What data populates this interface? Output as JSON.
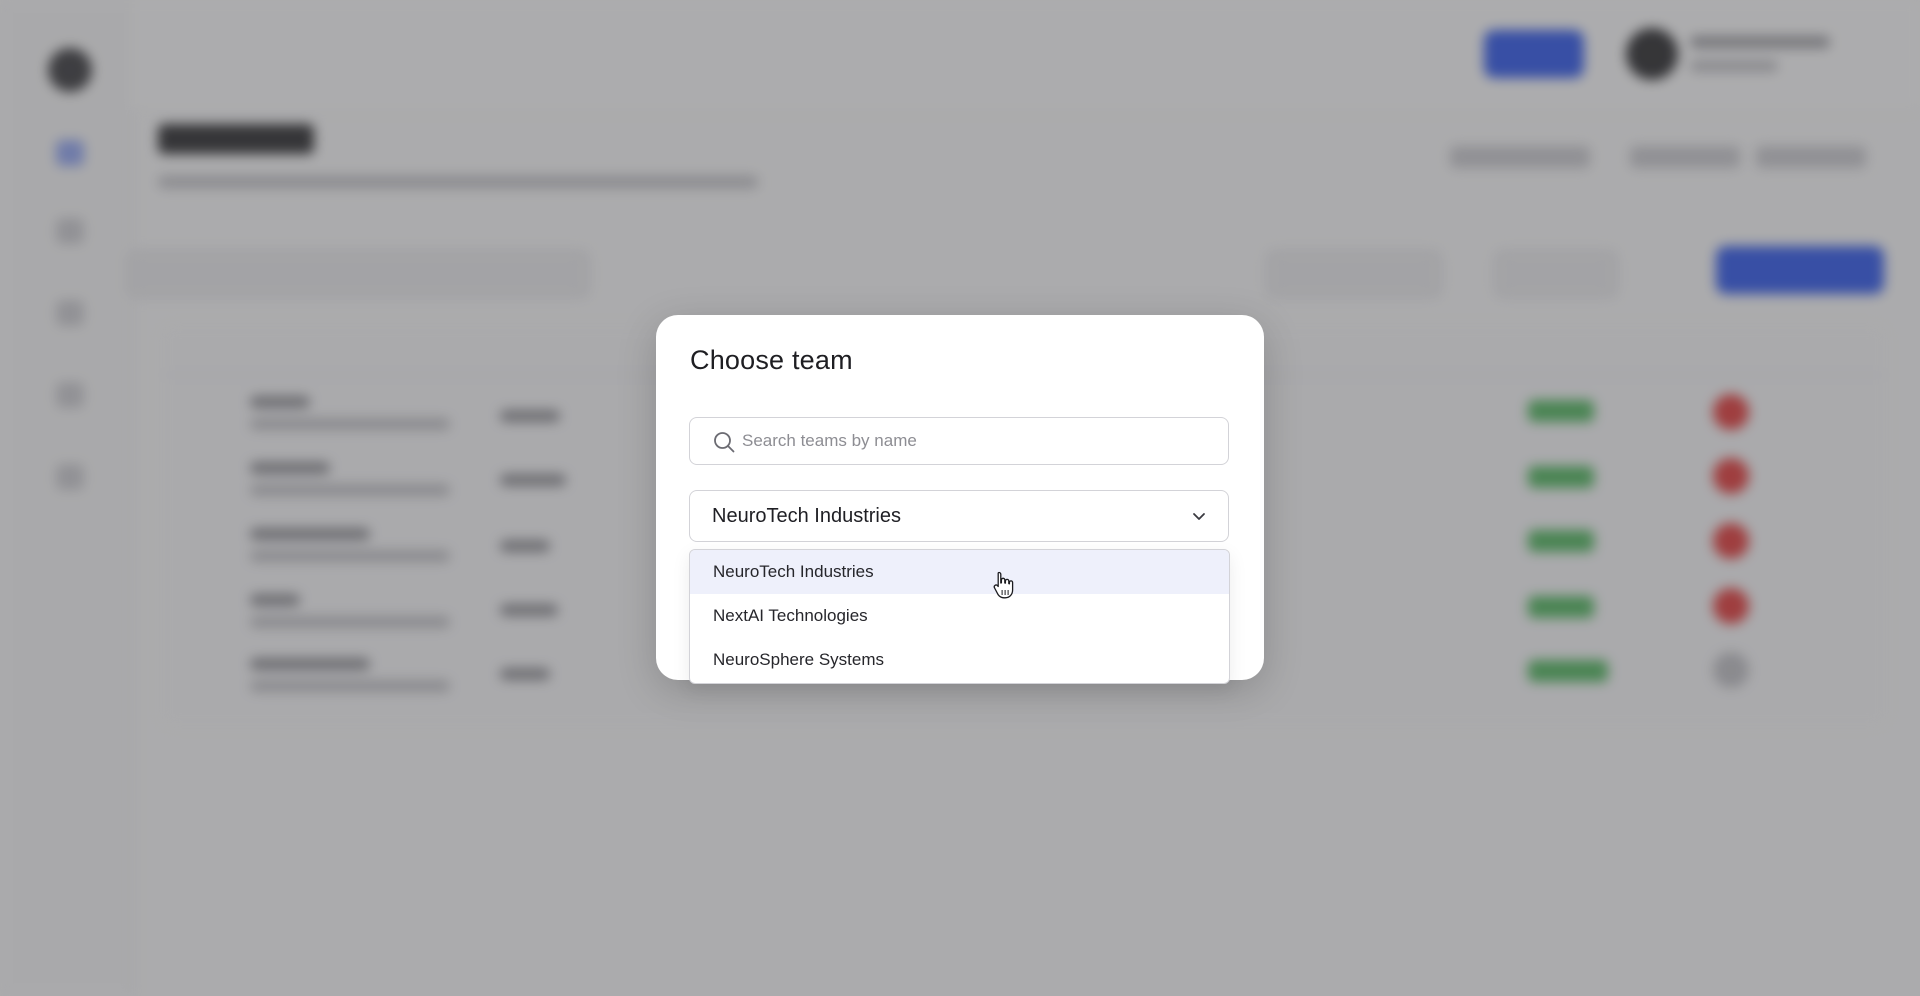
{
  "modal": {
    "title": "Choose team",
    "search": {
      "placeholder": "Search teams by name",
      "value": ""
    },
    "select": {
      "selected": "NeuroTech Industries"
    },
    "options": [
      {
        "label": "NeuroTech Industries",
        "hovered": true
      },
      {
        "label": "NextAI Technologies",
        "hovered": false
      },
      {
        "label": "NeuroSphere Systems",
        "hovered": false
      }
    ]
  },
  "icons": {
    "search": "search-icon",
    "chevron": "chevron-down-icon",
    "cursor": "hand-pointer-icon"
  },
  "colors": {
    "overlay": "#46464a",
    "primary": "#2f57e8",
    "hover_option": "#eef0fb",
    "status_green": "#4fb35d",
    "status_red": "#e03a3a"
  }
}
